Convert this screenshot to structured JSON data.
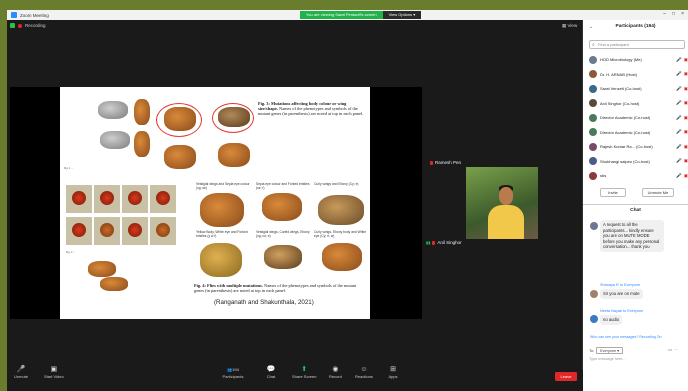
{
  "window": {
    "title": "Zoom Meeting",
    "share_message": "You are viewing Sarat Pentaoff's screen",
    "view_options": "View Options ▾",
    "recording": "Recording",
    "view": "View"
  },
  "slide": {
    "fig3_caption_bold": "Fig. 3: Mutations affecting body colour or wing size/shape.",
    "fig3_caption_rest": " Names of the phenotypes and symbols of the mutant genes (in parenthesis) are noted at top in each panel.",
    "fig4_caption_bold": "Fig. 4: Flies with multiple mutations.",
    "fig4_caption_rest": " Names of the phenotypes and symbols of the mutant genes (in parenthesis) are noted at top in each panel.",
    "citation": "(Ranganath and Shakunthala, 2021)",
    "panel_labels": [
      "Vestigial wings and Sepia eye colour (vg; se)",
      "Sepia eye colour and Forked bristles (se; f)",
      "Curly wings and Ebony (Cy; e)",
      "Yellow Body, White eye and Forked bristles (y w f)",
      "Vestigial wings, Curled wings, Ebony (vg; cu; e)",
      "Curly wings, Ebony body and White eye (Cy; e; w)"
    ]
  },
  "video": {
    "tile1_name": "Ramesh Pen",
    "tile2_name": "Anil Singhor"
  },
  "toolbar": {
    "unmute": "Unmute",
    "start_video": "Start Video",
    "participants": "Participants",
    "participants_count": "194",
    "chat": "Chat",
    "share_screen": "Share Screen",
    "record": "Record",
    "reactions": "Reactions",
    "apps": "Apps",
    "leave": "Leave"
  },
  "participants": {
    "title": "Participants (194)",
    "search_placeholder": "Find a participant",
    "list": [
      {
        "name": "HOD Microbiology (Me)",
        "color": "#6b7a8f"
      },
      {
        "name": "Dr. H. ARNAB (Host)",
        "color": "#8a5a3a"
      },
      {
        "name": "Sarat Venzelt (Co-host)",
        "color": "#3a6a8a"
      },
      {
        "name": "Anil Singhor (Co-host)",
        "color": "#5a4a3a"
      },
      {
        "name": "Director Academic (Co-host)",
        "color": "#4a7a5a"
      },
      {
        "name": "Director Academic (Co-host)",
        "color": "#4a7a5a"
      },
      {
        "name": "Rajesh Kumar Ra... (Co-host)",
        "color": "#7a4a6a"
      },
      {
        "name": "Shubhangi saipeo (Co-host)",
        "color": "#4a5a8a"
      },
      {
        "name": "sbs",
        "color": "#8a3a3a"
      }
    ],
    "invite": "Invite",
    "unmute_me": "Unmute Me"
  },
  "chat": {
    "title": "Chat",
    "messages": [
      {
        "text": "A request to all the participants... kindly ensure you are on MUTE MODE before you make any personal conversation... thank you"
      },
      {
        "from": "Shanaya R to Everyone",
        "text": "Sir you are on mute"
      },
      {
        "from": "Neeta Nayak to Everyone",
        "text": "no audio"
      }
    ],
    "who_can_see": "Who can see your messages? Recording On",
    "to_label": "To:",
    "to_value": "Everyone ▾",
    "input_placeholder": "Type message here..."
  }
}
